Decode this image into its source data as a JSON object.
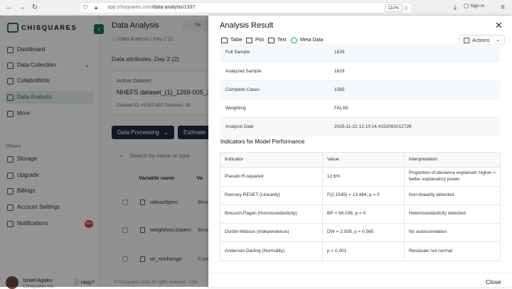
{
  "browser": {
    "url_host": "app.chisquares.com",
    "url_path": "/data-analysis/1337",
    "zoom": "110%",
    "sign_in": "Sign in"
  },
  "sidebar": {
    "logo": "CHISQUARES",
    "items": [
      {
        "label": "Dashboard",
        "icon": "grid-icon"
      },
      {
        "label": "Data Collection",
        "icon": "clipboard-icon"
      },
      {
        "label": "CollaboWrite",
        "icon": "pen-icon"
      },
      {
        "label": "Data Analysis",
        "icon": "chart-icon"
      },
      {
        "label": "More",
        "icon": "more-icon"
      }
    ],
    "others_label": "Others",
    "other_items": [
      {
        "label": "Storage",
        "icon": "storage-icon"
      },
      {
        "label": "Upgrade",
        "icon": "upgrade-icon"
      },
      {
        "label": "Billings",
        "icon": "billing-icon"
      },
      {
        "label": "Account Settings",
        "icon": "settings-icon"
      },
      {
        "label": "Notifications",
        "icon": "bell-icon",
        "badge": "99+"
      }
    ],
    "user_name": "Israel Agaku",
    "user_sub": "Chisquares Inc",
    "help": "Help?"
  },
  "main": {
    "title": "Data Analysis",
    "search_placeholder": "Se",
    "breadcrumb": "/ Data Analysis / Day 2 (2)",
    "attributes": "Data attributes: Day 2 (2)",
    "active_label": "Active Dataset",
    "active_name": "NHEFS dataset_(1)_1269-005_2",
    "active_meta": "Dataset ID: #1337-002    Columns: 99",
    "btn_processing": "Data Processing",
    "btn_estimate": "Estimate",
    "var_search": "Search by name or type",
    "var_header": "Variable name",
    "var_header_type": "Va",
    "variables": [
      {
        "name": "wtloss5perc",
        "type": "Bina"
      },
      {
        "name": "weightloss10perc",
        "type": "Bina"
      },
      {
        "name": "wt_reichange",
        "type": "Conti"
      }
    ],
    "copyright": "© Chisquares 2024 All rights reserved · Chis"
  },
  "panel": {
    "title": "Analysis Result",
    "tabs": [
      {
        "label": "Table",
        "icon": "table-icon"
      },
      {
        "label": "Plot",
        "icon": "plot-icon"
      },
      {
        "label": "Text",
        "icon": "text-icon"
      },
      {
        "label": "Meta Data",
        "icon": "metadata-icon"
      }
    ],
    "actions": "Actions",
    "summary": [
      {
        "key": "Full Sample",
        "value": "1629"
      },
      {
        "key": "Analyzed Sample",
        "value": "1629"
      },
      {
        "key": "Complete Cases",
        "value": "1565"
      },
      {
        "key": "Weighting",
        "value": "FALSE"
      },
      {
        "key": "Analysis Date",
        "value": "2025-11-22 12:10:14.4152081012726"
      }
    ],
    "indicators_heading": "Indicators for Model Performance",
    "table_headers": [
      "Indicator",
      "Value",
      "Interpretation"
    ],
    "table_rows": [
      {
        "indicator": "Pseudo R-squared",
        "value": "12.6%",
        "interpretation": "Proportion of deviance explained: higher = better explanatory power"
      },
      {
        "indicator": "Ramsey RESET (Linearity)",
        "value": "F(2,1545) = 13.484, p = 0",
        "interpretation": "Non-linearity detected"
      },
      {
        "indicator": "Breusch-Pagan (Homoscedasticity)",
        "value": "BP = 94.036, p = 0",
        "interpretation": "Heteroscedasticity detected"
      },
      {
        "indicator": "Durbin-Watson (Independence)",
        "value": "DW = 2.009, p = 0.565",
        "interpretation": "No autocorrelation"
      },
      {
        "indicator": "Anderson-Darling (Normality)",
        "value": "p < 0.001",
        "interpretation": "Residuals not normal"
      }
    ],
    "close": "Close"
  }
}
